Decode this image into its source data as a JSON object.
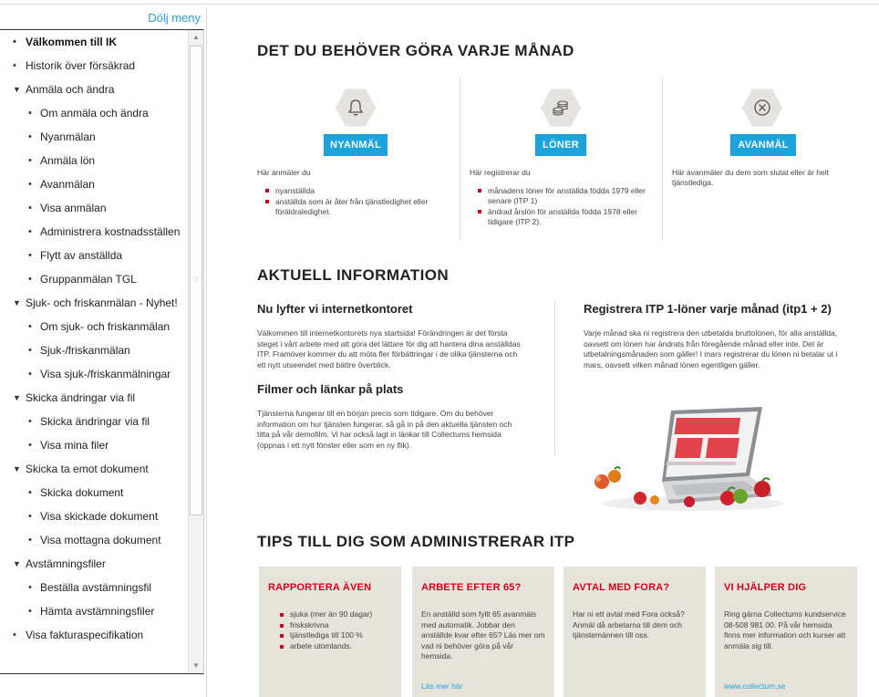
{
  "sidebar": {
    "hide_menu": "Dölj meny",
    "items": [
      {
        "label": "Välkommen till IK",
        "level": 1,
        "marker": "bullet",
        "bold": true
      },
      {
        "label": "Historik över försäkrad",
        "level": 1,
        "marker": "bullet"
      },
      {
        "label": "Anmäla och ändra",
        "level": 1,
        "marker": "expanded"
      },
      {
        "label": "Om anmäla och ändra",
        "level": 2,
        "marker": "bullet"
      },
      {
        "label": "Nyanmälan",
        "level": 2,
        "marker": "bullet"
      },
      {
        "label": "Anmäla lön",
        "level": 2,
        "marker": "bullet"
      },
      {
        "label": "Avanmälan",
        "level": 2,
        "marker": "bullet"
      },
      {
        "label": "Visa anmälan",
        "level": 2,
        "marker": "bullet"
      },
      {
        "label": "Administrera kostnadsställen",
        "level": 2,
        "marker": "bullet"
      },
      {
        "label": "Flytt av anställda",
        "level": 2,
        "marker": "bullet"
      },
      {
        "label": "Gruppanmälan TGL",
        "level": 2,
        "marker": "bullet"
      },
      {
        "label": "Sjuk- och friskanmälan - Nyhet!",
        "level": 1,
        "marker": "expanded"
      },
      {
        "label": "Om sjuk- och friskanmälan",
        "level": 2,
        "marker": "bullet"
      },
      {
        "label": "Sjuk-/friskanmälan",
        "level": 2,
        "marker": "bullet"
      },
      {
        "label": "Visa sjuk-/friskanmälningar",
        "level": 2,
        "marker": "bullet"
      },
      {
        "label": "Skicka ändringar via fil",
        "level": 1,
        "marker": "expanded"
      },
      {
        "label": "Skicka ändringar via fil",
        "level": 2,
        "marker": "bullet"
      },
      {
        "label": "Visa mina filer",
        "level": 2,
        "marker": "bullet"
      },
      {
        "label": "Skicka ta emot dokument",
        "level": 1,
        "marker": "expanded"
      },
      {
        "label": "Skicka dokument",
        "level": 2,
        "marker": "bullet"
      },
      {
        "label": "Visa skickade dokument",
        "level": 2,
        "marker": "bullet"
      },
      {
        "label": "Visa mottagna dokument",
        "level": 2,
        "marker": "bullet"
      },
      {
        "label": "Avstämningsfiler",
        "level": 1,
        "marker": "expanded"
      },
      {
        "label": "Beställa avstämningsfil",
        "level": 2,
        "marker": "bullet"
      },
      {
        "label": "Hämta avstämningsfiler",
        "level": 2,
        "marker": "bullet"
      },
      {
        "label": "Visa fakturaspecifikation",
        "level": 1,
        "marker": "bullet"
      }
    ]
  },
  "monthly": {
    "heading": "DET DU BEHÖVER GÖRA VARJE MÅNAD",
    "columns": [
      {
        "icon": "bell-icon",
        "button": "NYANMÄL",
        "intro": "Här anmäler du",
        "list": [
          "nyanställda",
          "anställda som är åter från tjänstledighet eller föräldraledighet."
        ]
      },
      {
        "icon": "coins-icon",
        "button": "LÖNER",
        "intro": "Här registrerar du",
        "list": [
          "månadens löner för anställda födda 1979 eller senare (ITP 1)",
          "ändrad årslön för anställda födda 1978 eller tidigare (ITP 2)."
        ]
      },
      {
        "icon": "close-circle-icon",
        "button": "AVANMÄL",
        "intro": "Här avanmäler du dem som slutat eller är helt tjänstlediga."
      }
    ]
  },
  "info": {
    "heading": "AKTUELL INFORMATION",
    "left": {
      "title1": "Nu lyfter vi internetkontoret",
      "text1": "Välkommen till internetkontorets nya startsida! Förändringen är det första steget i vårt arbete med att göra det lättare för dig att hantera dina anställdas ITP. Framöver kommer du att möta fler förbättringar i de olika tjänsterna och ett nytt utseendet med bättre överblick.",
      "title2": "Filmer och länkar på plats",
      "text2": "Tjänsterna fungerar till en början precis som tidigare. Om du behöver information om hur tjänsten fungerar, så gå in på den aktuella tjänsten och titta på vår demofilm. Vi har också lagt in länkar till Collectums hemsida (öppnas i ett nytt fönster eller som en ny flik)."
    },
    "right": {
      "title": "Registrera ITP 1-löner varje månad (itp1 + 2)",
      "text": "Varje månad ska ni registrera den utbetalda bruttolönen, för alla anställda, oavsett om lönen har ändrats från föregående månad eller inte. Det är utbetalningsmånaden som gäller! I mars registrerar du lönen ni betalar ut i mars, oavsett vilken månad lönen egentligen gäller."
    }
  },
  "tips": {
    "heading": "TIPS TILL DIG SOM ADMINISTRERAR ITP",
    "cards": [
      {
        "title": "RAPPORTERA ÄVEN",
        "list": [
          "sjuka (mer än 90 dagar)",
          "friskskrivna",
          "tjänstlediga till 100 %",
          "arbete utomlands."
        ]
      },
      {
        "title": "ARBETE EFTER 65?",
        "text": "En anställd som fyllt 65 avanmäls med automatik. Jobbar den anställde kvar efter 65? Läs mer om vad ni behöver göra på vår hemsida.",
        "link": "Läs mer här"
      },
      {
        "title": "AVTAL MED FORA?",
        "text": "Har ni ett avtal med Fora också? Anmäl då arbetarna till dem och tjänstemännen till oss."
      },
      {
        "title": "VI HJÄLPER DIG",
        "text": "Ring gärna Collectums kundservice 08-508 981 00. På vår hemsida finns mer information och kurser att anmäla sig till.",
        "link": "www.collectum.se"
      }
    ]
  },
  "colors": {
    "accent_blue": "#1ba3dd",
    "brand_red": "#d0021b",
    "tip_bg": "#e6e3da"
  }
}
